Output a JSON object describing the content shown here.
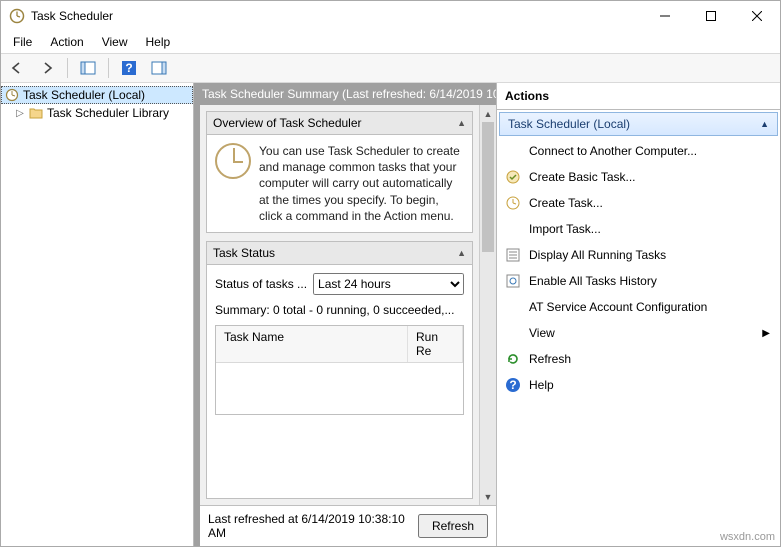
{
  "window": {
    "title": "Task Scheduler"
  },
  "menubar": {
    "file": "File",
    "action": "Action",
    "view": "View",
    "help": "Help"
  },
  "tree": {
    "root": "Task Scheduler (Local)",
    "library": "Task Scheduler Library"
  },
  "summary": {
    "header": "Task Scheduler Summary (Last refreshed: 6/14/2019 10:3",
    "overview_title": "Overview of Task Scheduler",
    "overview_text": "You can use Task Scheduler to create and manage common tasks that your computer will carry out automatically at the times you specify. To begin, click a command in the Action menu.",
    "status_title": "Task Status",
    "status_label": "Status of tasks ...",
    "status_dropdown": "Last 24 hours",
    "status_summary": "Summary: 0 total - 0 running, 0 succeeded,...",
    "table_col1": "Task Name",
    "table_col2": "Run Re",
    "footer_text": "Last refreshed at 6/14/2019 10:38:10 AM",
    "refresh_btn": "Refresh"
  },
  "actions": {
    "header": "Actions",
    "group": "Task Scheduler (Local)",
    "items": [
      "Connect to Another Computer...",
      "Create Basic Task...",
      "Create Task...",
      "Import Task...",
      "Display All Running Tasks",
      "Enable All Tasks History",
      "AT Service Account Configuration",
      "View",
      "Refresh",
      "Help"
    ]
  },
  "watermark": "wsxdn.com"
}
